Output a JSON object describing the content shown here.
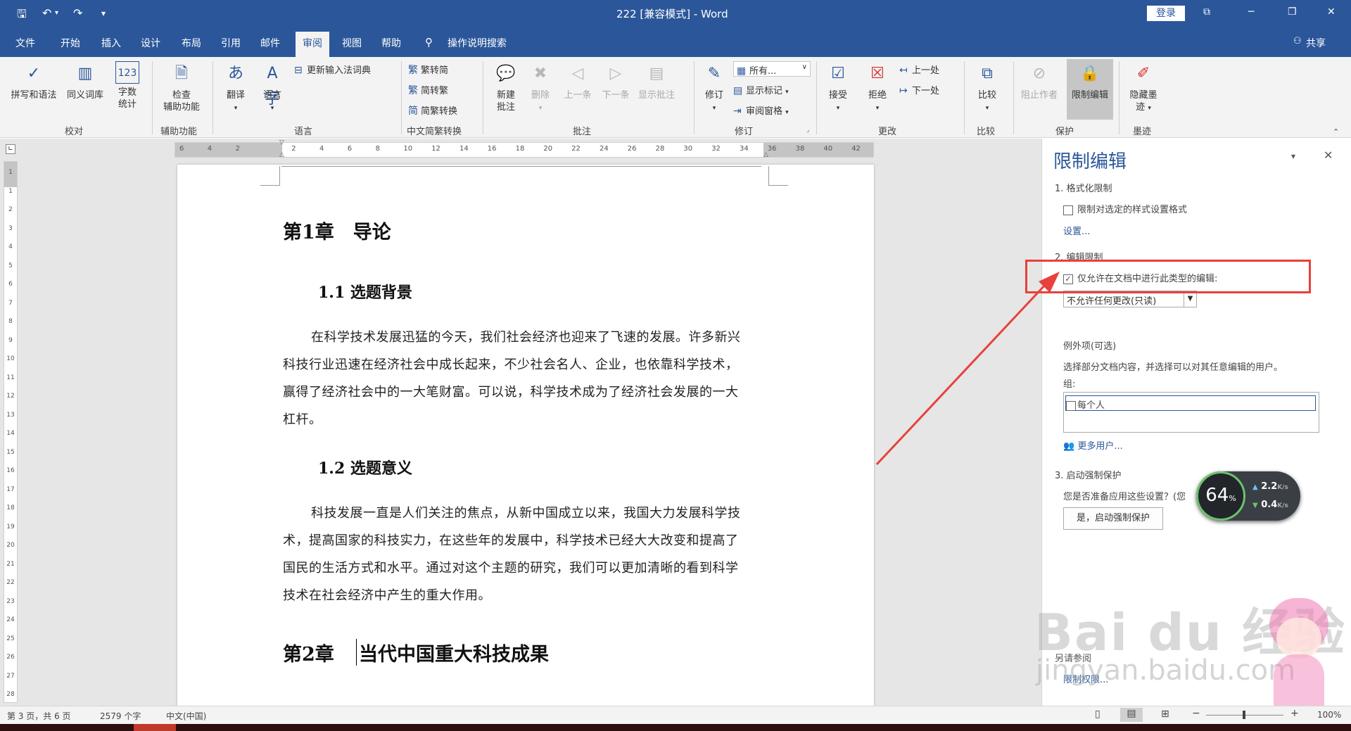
{
  "titlebar": {
    "doc_title": "222 [兼容模式] - Word",
    "login_label": "登录",
    "minimize": "─",
    "restore": "❐",
    "close": "✕",
    "ribbon_display": "⧉",
    "qat_more": "▾"
  },
  "tabs": [
    "文件",
    "开始",
    "插入",
    "设计",
    "布局",
    "引用",
    "邮件",
    "审阅",
    "视图",
    "帮助"
  ],
  "active_tab": "审阅",
  "tell_me": "操作说明搜索",
  "share_label": "共享",
  "ribbon": {
    "proofing": {
      "spell": "拼写和语法",
      "thesaurus": "同义词库",
      "wordcount_l1": "字数",
      "wordcount_l2": "统计",
      "group": "校对"
    },
    "accessibility": {
      "check_l1": "检查",
      "check_l2": "辅助功能",
      "group": "辅助功能"
    },
    "language": {
      "translate": "翻译",
      "language": "语言",
      "update_ime": "更新输入法词典",
      "group": "语言"
    },
    "chinese": {
      "t2s": "繁转简",
      "s2t": "简转繁",
      "convert": "简繁转换",
      "group": "中文简繁转换"
    },
    "comments": {
      "new_l1": "新建",
      "new_l2": "批注",
      "delete": "删除",
      "prev": "上一条",
      "next": "下一条",
      "show": "显示批注",
      "group": "批注"
    },
    "tracking": {
      "track": "修订",
      "markup": "所有...",
      "show_markup": "显示标记",
      "pane": "审阅窗格",
      "group": "修订"
    },
    "changes": {
      "accept": "接受",
      "reject": "拒绝",
      "prev": "上一处",
      "next": "下一处",
      "group": "更改"
    },
    "compare": {
      "compare": "比较",
      "group": "比较"
    },
    "protect": {
      "block": "阻止作者",
      "restrict": "限制编辑",
      "group": "保护"
    },
    "ink": {
      "hide_l1": "隐藏墨",
      "hide_l2": "迹",
      "group": "墨迹"
    }
  },
  "ruler_ticks": [
    "6",
    "4",
    "2",
    "",
    "2",
    "4",
    "6",
    "8",
    "10",
    "12",
    "14",
    "16",
    "18",
    "20",
    "22",
    "24",
    "26",
    "28",
    "30",
    "32",
    "34",
    "36",
    "38",
    "40",
    "42"
  ],
  "vruler_ticks": [
    "1",
    "1",
    "2",
    "3",
    "4",
    "5",
    "6",
    "7",
    "8",
    "9",
    "10",
    "11",
    "12",
    "13",
    "14",
    "15",
    "16",
    "17",
    "18",
    "19",
    "20",
    "21",
    "22",
    "23",
    "24",
    "25",
    "26",
    "27",
    "28"
  ],
  "document": {
    "ch1": "第1章　导论",
    "s11": "1.1 选题背景",
    "p1_l1": "在科学技术发展迅猛的今天，我们社会经济也迎来了飞速的发展。许多新兴",
    "p1_l2": "科技行业迅速在经济社会中成长起来，不少社会名人、企业，也依靠科学技术，",
    "p1_l3": "赢得了经济社会中的一大笔财富。可以说，科学技术成为了经济社会发展的一大",
    "p1_l4": "杠杆。",
    "s12": "1.2 选题意义",
    "p2_l1": "科技发展一直是人们关注的焦点，从新中国成立以来，我国大力发展科学技",
    "p2_l2": "术，提高国家的科技实力，在这些年的发展中，科学技术已经大大改变和提高了",
    "p2_l3": "国民的生活方式和水平。通过对这个主题的研究，我们可以更加清晰的看到科学",
    "p2_l4": "技术在社会经济中产生的重大作用。",
    "ch2_num": "第2章",
    "ch2_title": "当代中国重大科技成果"
  },
  "pane": {
    "title": "限制编辑",
    "sec1": "1. 格式化限制",
    "limit_format": "限制对选定的样式设置格式",
    "settings": "设置...",
    "sec2": "2. 编辑限制",
    "allow_only": "仅允许在文档中进行此类型的编辑:",
    "allow_checked": true,
    "edit_type": "不允许任何更改(只读)",
    "exceptions": "例外项(可选)",
    "exceptions_desc": "选择部分文档内容，并选择可以对其任意编辑的用户。",
    "groups": "组:",
    "everyone": "每个人",
    "more_users": "更多用户...",
    "sec3": "3. 启动强制保护",
    "ready": "您是否准备应用这些设置？(您",
    "start_btn": "是，启动强制保护",
    "see_also": "另请参阅",
    "restrict_perm": "限制权限..."
  },
  "speed_widget": {
    "percent": "64",
    "unit": "%",
    "up": "2.2",
    "down": "0.4",
    "rate_unit": "K/s"
  },
  "watermark": {
    "brand": "Bai du 经验",
    "url": "jingyan.baidu.com"
  },
  "status": {
    "page": "第 3 页，共 6 页",
    "words": "2579 个字",
    "lang": "中文(中国)",
    "zoom": "100%"
  },
  "colors": {
    "accent": "#2b579a",
    "highlight": "#e8413c"
  }
}
